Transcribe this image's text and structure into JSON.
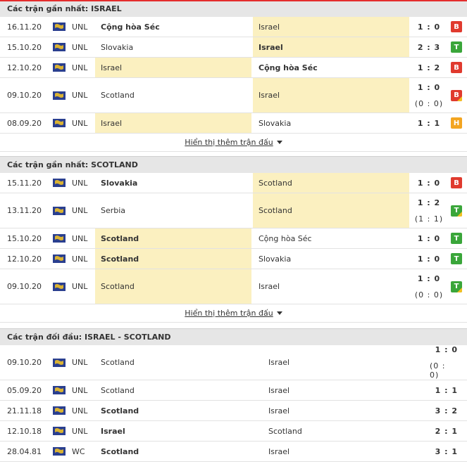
{
  "colors": {
    "accent_top": "#e42d2d",
    "highlight": "#fbf0c0",
    "loss": "#e03a2e",
    "win": "#3aa63a",
    "draw": "#f3a521"
  },
  "more_label": "Hiển thị thêm trận đấu",
  "sections": [
    {
      "title": "Các trận gần nhất: ISRAEL",
      "matches": [
        {
          "date": "16.11.20",
          "league": "UNL",
          "home": "Cộng hòa Séc",
          "away": "Israel",
          "score": "1 : 0",
          "ht": "",
          "result": "B",
          "hl": "away",
          "bold": "home"
        },
        {
          "date": "15.10.20",
          "league": "UNL",
          "home": "Slovakia",
          "away": "Israel",
          "score": "2 : 3",
          "ht": "",
          "result": "T",
          "hl": "away",
          "bold": "away"
        },
        {
          "date": "12.10.20",
          "league": "UNL",
          "home": "Israel",
          "away": "Cộng hòa Séc",
          "score": "1 : 2",
          "ht": "",
          "result": "B",
          "hl": "home",
          "bold": "away"
        },
        {
          "date": "09.10.20",
          "league": "UNL",
          "home": "Scotland",
          "away": "Israel",
          "score": "1 : 0",
          "ht": "(0 : 0)",
          "result": "B",
          "hl": "away",
          "bold": "",
          "corner": true
        },
        {
          "date": "08.09.20",
          "league": "UNL",
          "home": "Israel",
          "away": "Slovakia",
          "score": "1 : 1",
          "ht": "",
          "result": "H",
          "hl": "home",
          "bold": ""
        }
      ]
    },
    {
      "title": "Các trận gần nhất: SCOTLAND",
      "matches": [
        {
          "date": "15.11.20",
          "league": "UNL",
          "home": "Slovakia",
          "away": "Scotland",
          "score": "1 : 0",
          "ht": "",
          "result": "B",
          "hl": "away",
          "bold": "home"
        },
        {
          "date": "13.11.20",
          "league": "UNL",
          "home": "Serbia",
          "away": "Scotland",
          "score": "1 : 2",
          "ht": "(1 : 1)",
          "result": "T",
          "hl": "away",
          "bold": "",
          "corner": true
        },
        {
          "date": "15.10.20",
          "league": "UNL",
          "home": "Scotland",
          "away": "Cộng hòa Séc",
          "score": "1 : 0",
          "ht": "",
          "result": "T",
          "hl": "home",
          "bold": "home"
        },
        {
          "date": "12.10.20",
          "league": "UNL",
          "home": "Scotland",
          "away": "Slovakia",
          "score": "1 : 0",
          "ht": "",
          "result": "T",
          "hl": "home",
          "bold": "home"
        },
        {
          "date": "09.10.20",
          "league": "UNL",
          "home": "Scotland",
          "away": "Israel",
          "score": "1 : 0",
          "ht": "(0 : 0)",
          "result": "T",
          "hl": "home",
          "bold": "",
          "corner": true
        }
      ]
    },
    {
      "title": "Các trận đối đầu: ISRAEL - SCOTLAND",
      "matches": [
        {
          "date": "09.10.20",
          "league": "UNL",
          "home": "Scotland",
          "away": "Israel",
          "score": "1 : 0",
          "ht": "(0 : 0)",
          "result": "",
          "hl": "",
          "bold": ""
        },
        {
          "date": "05.09.20",
          "league": "UNL",
          "home": "Scotland",
          "away": "Israel",
          "score": "1 : 1",
          "ht": "",
          "result": "",
          "hl": "",
          "bold": ""
        },
        {
          "date": "21.11.18",
          "league": "UNL",
          "home": "Scotland",
          "away": "Israel",
          "score": "3 : 2",
          "ht": "",
          "result": "",
          "hl": "",
          "bold": "home"
        },
        {
          "date": "12.10.18",
          "league": "UNL",
          "home": "Israel",
          "away": "Scotland",
          "score": "2 : 1",
          "ht": "",
          "result": "",
          "hl": "",
          "bold": "home"
        },
        {
          "date": "28.04.81",
          "league": "WC",
          "home": "Scotland",
          "away": "Israel",
          "score": "3 : 1",
          "ht": "",
          "result": "",
          "hl": "",
          "bold": "home"
        }
      ]
    }
  ]
}
